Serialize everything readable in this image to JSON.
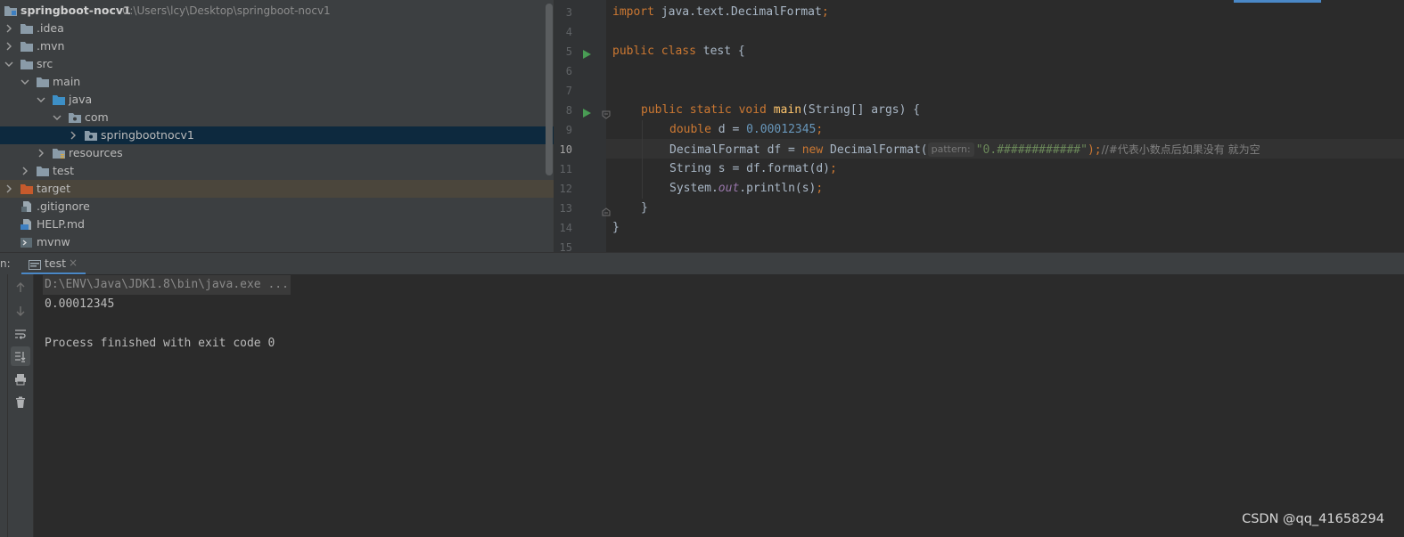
{
  "project": {
    "name": "springboot-nocv1",
    "path": "C:\\Users\\lcy\\Desktop\\springboot-nocv1"
  },
  "tree": {
    "items": [
      {
        "label": ".idea"
      },
      {
        "label": ".mvn"
      },
      {
        "label": "src"
      },
      {
        "label": "main"
      },
      {
        "label": "java"
      },
      {
        "label": "com"
      },
      {
        "label": "springbootnocv1"
      },
      {
        "label": "resources"
      },
      {
        "label": "test"
      },
      {
        "label": "target"
      },
      {
        "label": ".gitignore"
      },
      {
        "label": "HELP.md"
      },
      {
        "label": "mvnw"
      }
    ]
  },
  "editor": {
    "line_numbers": [
      "3",
      "4",
      "5",
      "6",
      "7",
      "8",
      "9",
      "10",
      "11",
      "12",
      "13",
      "14",
      "15"
    ],
    "current_line": "10",
    "code": {
      "l3_kw": "import",
      "l3_rest": " java.text.DecimalFormat",
      "l3_semi": ";",
      "l5_kw": "public class",
      "l5_rest": " test {",
      "l8_kw": "public static void",
      "l8_fn": "main",
      "l8_rest": "(String[] args) {",
      "l9_kw": "double",
      "l9_rest": " d = ",
      "l9_num": "0.00012345",
      "l9_semi": ";",
      "l10_a": "DecimalFormat df = ",
      "l10_kw": "new",
      "l10_b": " DecimalFormat(",
      "l10_hint": "pattern:",
      "l10_str": "\"0.############\"",
      "l10_c": ");",
      "l10_cmt": "//#代表小数点后如果没有 就为空",
      "l11_a": "String s = df.format(d)",
      "l11_semi": ";",
      "l12_a": "System.",
      "l12_field": "out",
      "l12_b": ".println(s)",
      "l12_semi": ";",
      "l13": "}",
      "l14": "}"
    }
  },
  "run": {
    "label": "n:",
    "tab_label": "test",
    "tab_close": "×",
    "console": [
      "D:\\ENV\\Java\\JDK1.8\\bin\\java.exe ...",
      "0.00012345",
      "",
      "Process finished with exit code 0"
    ]
  },
  "watermark": "CSDN @qq_41658294",
  "colors": {
    "keyword": "#cc7832",
    "number": "#6897bb",
    "string": "#6a8759",
    "comment": "#808080",
    "accent": "#4a88c7"
  }
}
